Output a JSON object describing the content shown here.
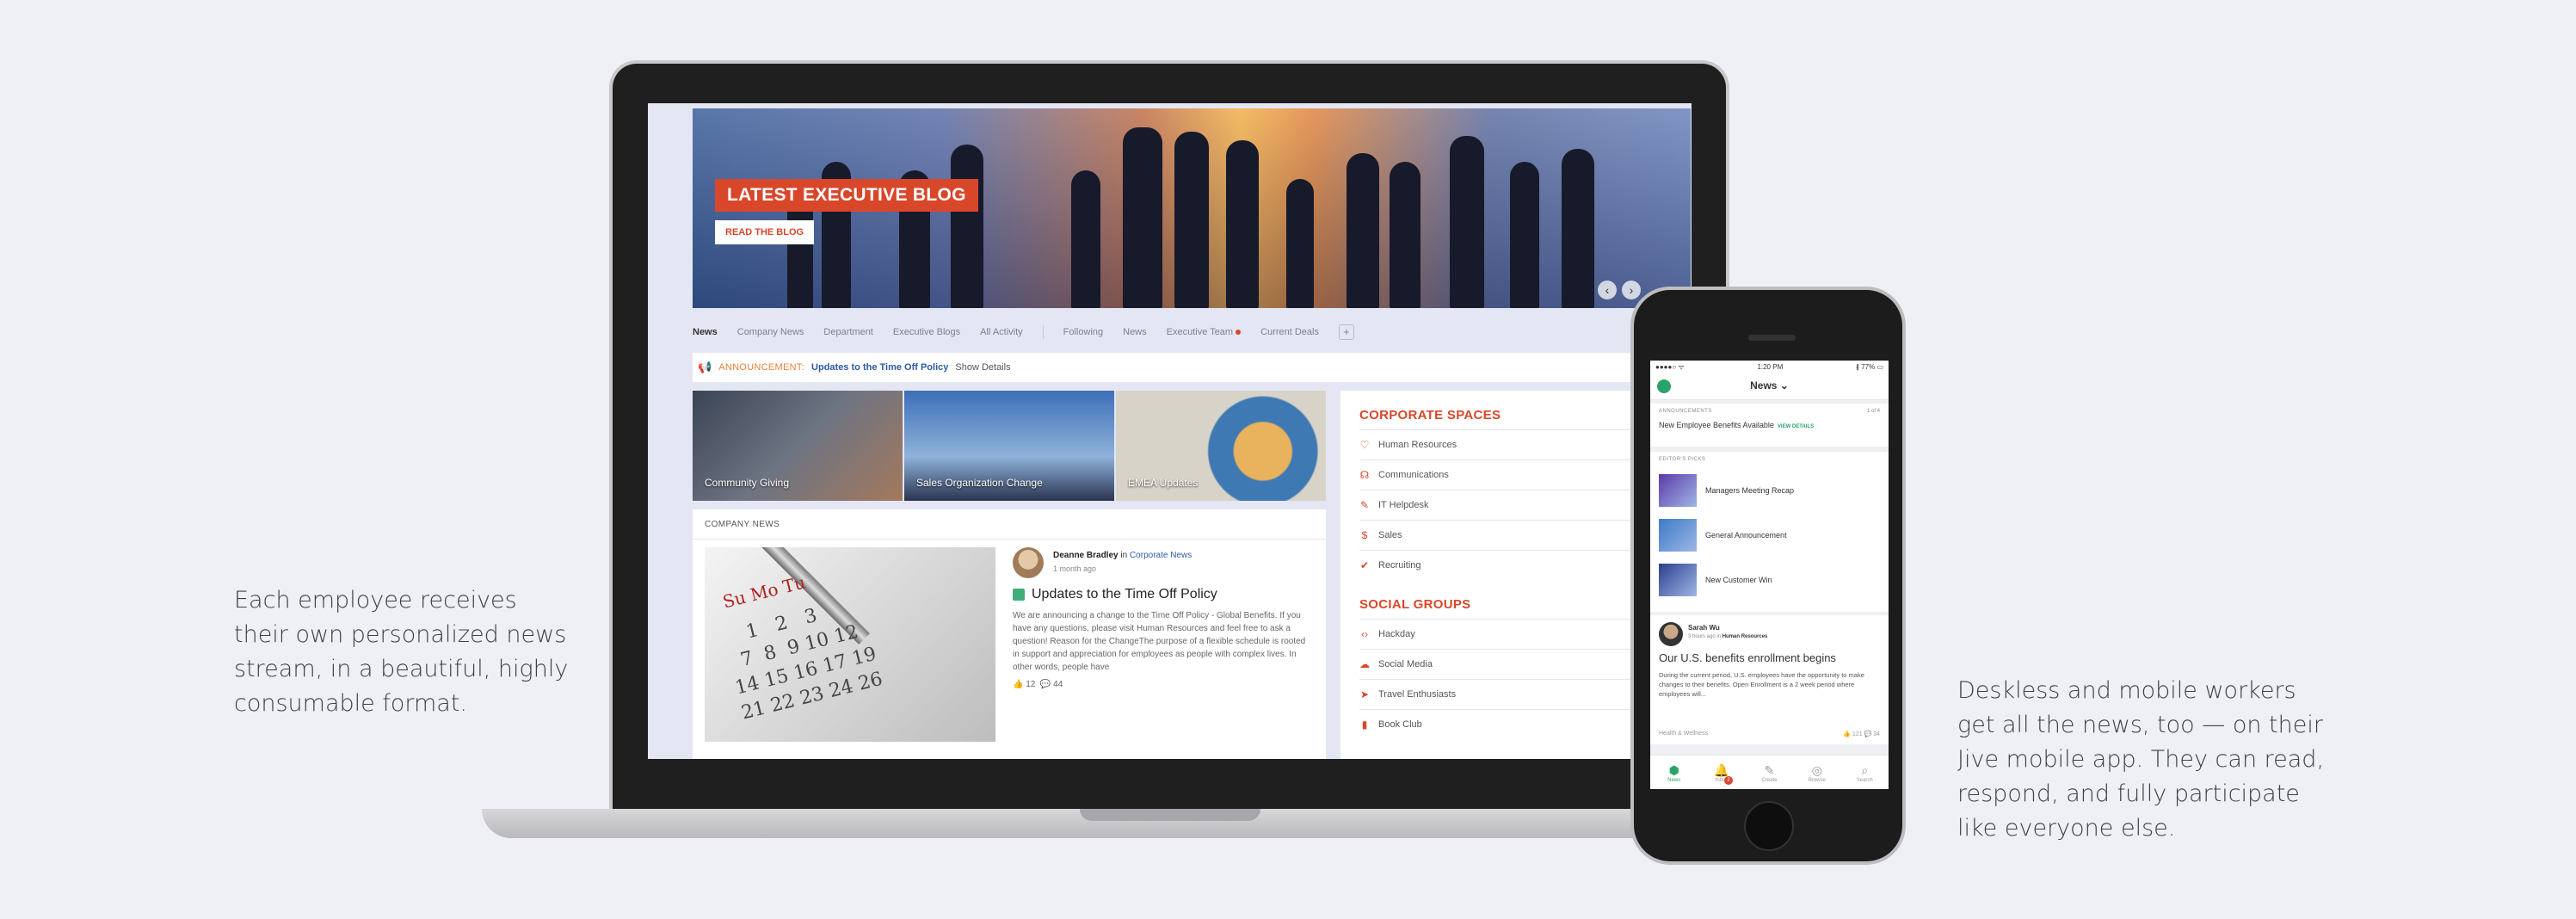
{
  "captions": {
    "left": "Each employee receives\ntheir own personalized news\nstream, in a beautiful, highly\nconsumable format.",
    "right": "Deskless and mobile workers\nget all the news, too — on their\nJive mobile app. They can read,\nrespond, and fully participate\nlike everyone else."
  },
  "desktop": {
    "hero": {
      "title": "LATEST EXECUTIVE BLOG",
      "link": "READ THE BLOG",
      "prev": "‹",
      "next": "›"
    },
    "tabs": [
      "News",
      "Company News",
      "Department",
      "Executive Blogs",
      "All Activity",
      "Following",
      "News",
      "Executive Team",
      "Current Deals"
    ],
    "tab_add": "+",
    "announcement": {
      "label": "ANNOUNCEMENT:",
      "title": "Updates to the Time Off Policy",
      "more": "Show Details"
    },
    "tiles": [
      "Community Giving",
      "Sales Organization Change",
      "EMEA Updates"
    ],
    "company_news": {
      "header": "COMPANY NEWS",
      "author": "Deanne Bradley",
      "in_text": "in",
      "place": "Corporate News",
      "time": "1 month ago",
      "post_title": "Updates to the Time Off Policy",
      "post_body": "We are announcing a change to the Time Off Policy - Global Benefits.   If you have any questions, please visit Human Resources and feel free to ask a question!   Reason for the ChangeThe purpose of a flexible schedule is rooted in support and appreciation for employees as people with complex lives. In other words, people have",
      "likes": "12",
      "comments": "44",
      "calendar_days": "Su Mo Tu",
      "calendar_numbers": "    1   2   3\n  7  8  9 10 12\n14 15 16 17 19\n21 22 23 24 26"
    },
    "corporate_spaces": {
      "title": "CORPORATE SPACES",
      "items": [
        {
          "icon": "♡",
          "label": "Human Resources"
        },
        {
          "icon": "☊",
          "label": "Communications"
        },
        {
          "icon": "✎",
          "label": "IT Helpdesk"
        },
        {
          "icon": "$",
          "label": "Sales"
        },
        {
          "icon": "✔",
          "label": "Recruiting"
        }
      ]
    },
    "social_groups": {
      "title": "SOCIAL GROUPS",
      "items": [
        {
          "icon": "‹›",
          "label": "Hackday"
        },
        {
          "icon": "☁",
          "label": "Social Media"
        },
        {
          "icon": "➤",
          "label": "Travel Enthusiasts"
        },
        {
          "icon": "▮",
          "label": "Book Club"
        }
      ]
    }
  },
  "mobile": {
    "status": {
      "carrier": "●●●●○ ᯤ",
      "time": "1:20 PM",
      "battery": "∦ 77% ▭"
    },
    "header_title": "News ⌄",
    "announcements": {
      "label": "ANNOUNCEMENTS",
      "count": "1 of 4",
      "text": "New Employee Benefits Available",
      "view": "VIEW DETAILS"
    },
    "picks": {
      "label": "EDITOR'S PICKS",
      "items": [
        {
          "label": "Managers Meeting Recap",
          "color": "#5b3aa8"
        },
        {
          "label": "General Announcement",
          "color": "#3c7bc9"
        },
        {
          "label": "New Customer Win",
          "color": "#2c3f8e"
        }
      ]
    },
    "post": {
      "name": "Sarah Wu",
      "meta_prefix": "3 hours ago in",
      "meta_place": "Human Resources",
      "title": "Our U.S. benefits enrollment begins",
      "body": "During the current period, U.S. employees have the opportunity to make changes to their benefits. Open Enrollment is a 2 week period where employees will...",
      "tag": "Health & Wellness",
      "stats": "👍 121   💬 34"
    },
    "tabbar": [
      {
        "glyph": "⬢",
        "label": "News"
      },
      {
        "glyph": "🔔",
        "label": "Inbox",
        "badge": "2"
      },
      {
        "glyph": "✎",
        "label": "Create"
      },
      {
        "glyph": "◎",
        "label": "Browse"
      },
      {
        "glyph": "⌕",
        "label": "Search"
      }
    ]
  }
}
